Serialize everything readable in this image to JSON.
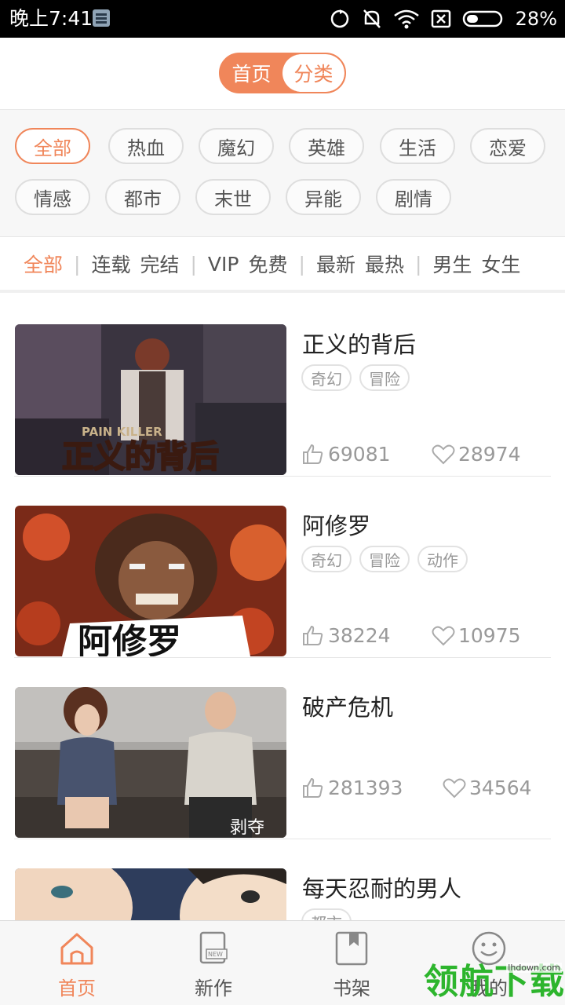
{
  "status_bar": {
    "time": "晚上7:41",
    "battery": "28%"
  },
  "header": {
    "tabs": [
      {
        "label": "首页",
        "active": true
      },
      {
        "label": "分类",
        "active": false
      }
    ]
  },
  "genres": [
    "全部",
    "热血",
    "魔幻",
    "英雄",
    "生活",
    "恋爱",
    "情感",
    "都市",
    "末世",
    "异能",
    "剧情"
  ],
  "filters": {
    "all": "全部",
    "serial": "连载",
    "finished": "完结",
    "vip": "VIP",
    "free": "免费",
    "newest": "最新",
    "hottest": "最热",
    "male": "男生",
    "female": "女生"
  },
  "comics": [
    {
      "title": "正义的背后",
      "tags": [
        "奇幻",
        "冒险"
      ],
      "likes": "69081",
      "favorites": "28974",
      "cover_text": "正义的背后",
      "cover_subtext": "PAIN KILLER"
    },
    {
      "title": "阿修罗",
      "tags": [
        "奇幻",
        "冒险",
        "动作"
      ],
      "likes": "38224",
      "favorites": "10975",
      "cover_text": "阿修罗"
    },
    {
      "title": "破产危机",
      "tags": [],
      "likes": "281393",
      "favorites": "34564",
      "cover_text": "剥夺"
    },
    {
      "title": "每天忍耐的男人",
      "tags": [
        "都市"
      ],
      "likes": "",
      "favorites": ""
    }
  ],
  "bottom_nav": [
    {
      "label": "首页",
      "icon": "home-icon",
      "active": true
    },
    {
      "label": "新作",
      "icon": "new-book-icon",
      "active": false
    },
    {
      "label": "书架",
      "icon": "bookshelf-icon",
      "active": false
    },
    {
      "label": "我的",
      "icon": "smiley-icon",
      "active": false
    }
  ],
  "watermark": {
    "text": "领航下载",
    "url": "lhdown.com"
  },
  "colors": {
    "accent": "#f0865a",
    "watermark": "#2db52d"
  }
}
